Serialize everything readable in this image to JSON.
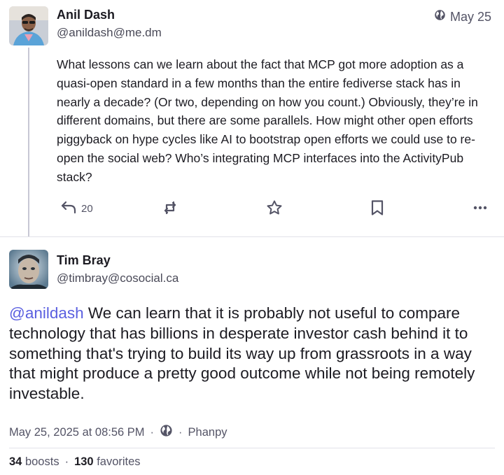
{
  "parent": {
    "author_name": "Anil Dash",
    "author_handle": "@anildash@me.dm",
    "date": "May 25",
    "body": "What lessons can we learn about the fact that MCP got more adoption as a quasi-open standard in a few months than the entire fediverse stack has in nearly a decade? (Or two, depending on how you count.) Obviously, they’re in different domains, but there are some parallels. How might other open efforts piggyback on hype cycles like AI to bootstrap open efforts we could use to re-open the social web? Who’s integrating MCP interfaces into the ActivityPub stack?",
    "reply_count": "20",
    "icons": [
      "globe-icon",
      "reply-icon",
      "boost-icon",
      "star-icon",
      "bookmark-icon",
      "more-icon"
    ]
  },
  "reply": {
    "author_name": "Tim Bray",
    "author_handle": "@timbray@cosocial.ca",
    "mention": "@anildash",
    "body": " We can learn that it is probably not useful to compare technology that has billions in desperate investor cash behind it to something that's trying to build its way up from grassroots in a way that might produce a pretty good outcome while not being remotely investable.",
    "timestamp": "May 25, 2025 at 08:56 PM",
    "separator": "·",
    "client": "Phanpy",
    "boosts_count": "34",
    "boosts_label": "boosts",
    "favorites_count": "130",
    "favorites_label": "favorites"
  },
  "colors": {
    "accent": "#5a5fe0",
    "text": "#1c1b22",
    "muted": "#545466",
    "thread_line": "#c7c7d4"
  }
}
